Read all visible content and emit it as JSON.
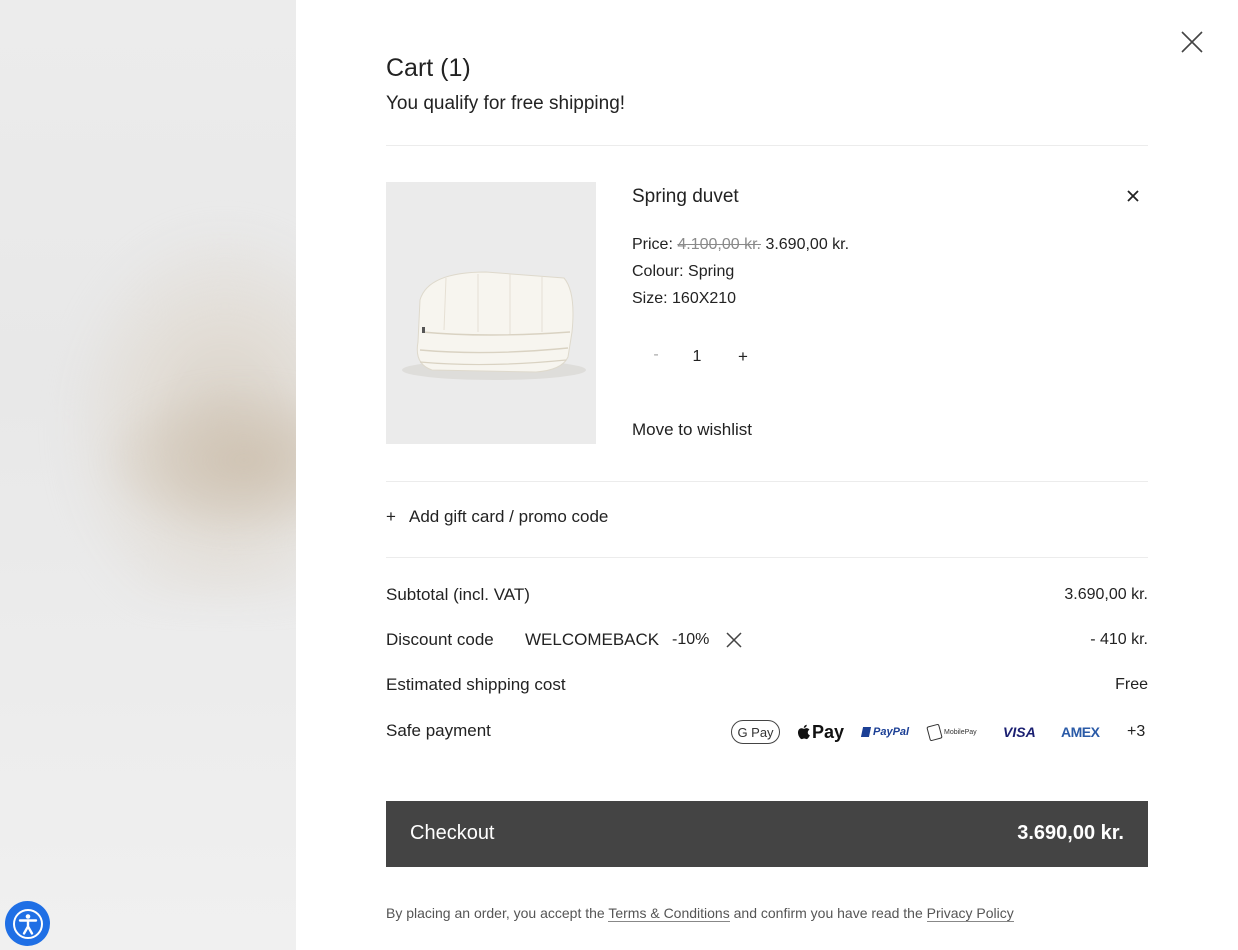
{
  "cart": {
    "title": "Cart (1)",
    "shipping_message": "You qualify for free shipping!"
  },
  "item": {
    "name": "Spring duvet",
    "price_label": "Price:",
    "old_price": "4.100,00 kr.",
    "new_price": "3.690,00 kr.",
    "colour": "Colour: Spring",
    "size": "Size: 160X210",
    "qty_minus": "-",
    "quantity": "1",
    "qty_plus": "+",
    "wishlist": "Move to wishlist"
  },
  "promo": {
    "plus": "+",
    "label": "Add gift card / promo code"
  },
  "summary": {
    "subtotal_label": "Subtotal (incl. VAT)",
    "subtotal_value": "3.690,00 kr.",
    "discount_label": "Discount code",
    "discount_code": "WELCOMEBACK",
    "discount_pct": "-10%",
    "discount_value": "- 410 kr.",
    "shipping_label": "Estimated shipping cost",
    "shipping_value": "Free",
    "payment_label": "Safe payment"
  },
  "payments": {
    "gpay": "G Pay",
    "applepay": "Pay",
    "paypal": "PayPal",
    "mobilepay": "MobilePay",
    "visa": "VISA",
    "amex": "AMEX",
    "more": "+3"
  },
  "checkout": {
    "label": "Checkout",
    "amount": "3.690,00 kr."
  },
  "legal": {
    "prefix": "By placing an order, you accept the ",
    "terms": "Terms & Conditions",
    "middle": " and confirm you have read the ",
    "privacy": "Privacy Policy"
  },
  "colors": {
    "checkout_bg": "#444444",
    "accessibility_blue": "#1f6fe5"
  },
  "icons": [
    "close-icon",
    "remove-item-icon",
    "remove-discount-icon",
    "accessibility-icon",
    "apple-icon"
  ]
}
